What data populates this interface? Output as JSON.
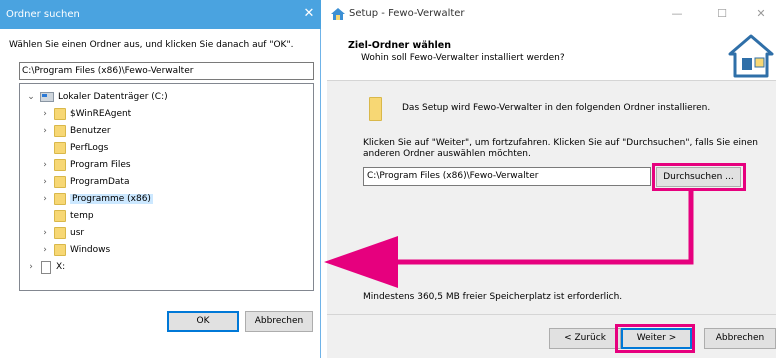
{
  "folder_dialog": {
    "title": "Ordner suchen",
    "close_glyph": "✕",
    "instruction": "Wählen Sie einen Ordner aus, und klicken Sie danach auf \"OK\".",
    "path_value": "C:\\Program Files (x86)\\Fewo-Verwalter",
    "tree": {
      "drive_label": "Lokaler Datenträger (C:)",
      "items": [
        {
          "label": "$WinREAgent",
          "expandable": true
        },
        {
          "label": "Benutzer",
          "expandable": true
        },
        {
          "label": "PerfLogs",
          "expandable": false
        },
        {
          "label": "Program Files",
          "expandable": true
        },
        {
          "label": "ProgramData",
          "expandable": true
        },
        {
          "label": "Programme (x86)",
          "expandable": true,
          "selected": true
        },
        {
          "label": "temp",
          "expandable": false
        },
        {
          "label": "usr",
          "expandable": true
        },
        {
          "label": "Windows",
          "expandable": true
        }
      ],
      "other_drive_label": "X:"
    },
    "ok_label": "OK",
    "cancel_label": "Abbrechen"
  },
  "setup_window": {
    "title": "Setup - Fewo-Verwalter",
    "minimize_glyph": "—",
    "maximize_glyph": "☐",
    "close_glyph": "✕",
    "header_title": "Ziel-Ordner wählen",
    "header_subtitle": "Wohin soll Fewo-Verwalter installiert werden?",
    "info_line": "Das Setup wird Fewo-Verwalter in den folgenden Ordner installieren.",
    "instruction": "Klicken Sie auf \"Weiter\", um fortzufahren. Klicken Sie auf \"Durchsuchen\", falls Sie einen anderen Ordner auswählen möchten.",
    "destination_value": "C:\\Program Files (x86)\\Fewo-Verwalter",
    "browse_label": "Durchsuchen ...",
    "disk_space_text": "Mindestens 360,5 MB freier Speicherplatz ist erforderlich.",
    "back_label": "< Zurück",
    "next_label": "Weiter >",
    "cancel_label": "Abbrechen"
  },
  "colors": {
    "highlight": "#e6007e",
    "dialog_titlebar": "#4aa3e0",
    "selection": "#cce8ff",
    "folder": "#f7d774"
  }
}
